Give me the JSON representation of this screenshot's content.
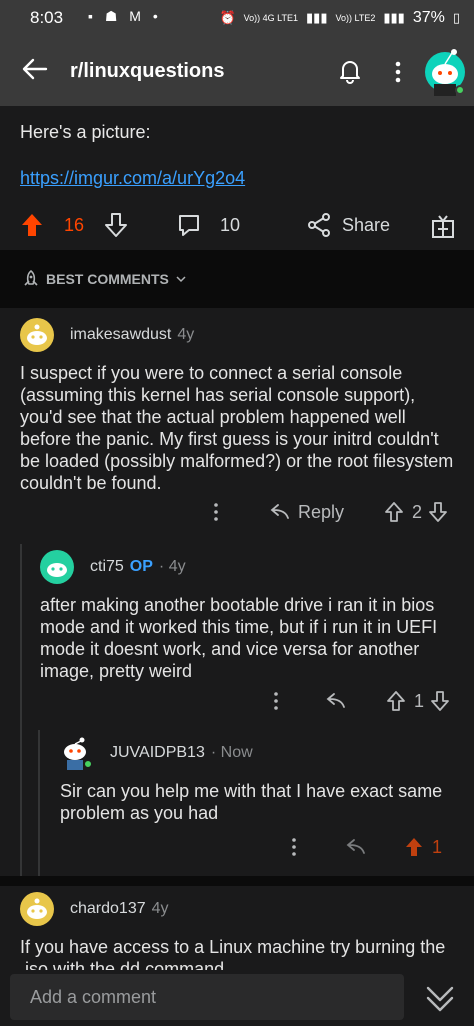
{
  "status_bar": {
    "time": "8:03",
    "left_icons": "▪ ☗ M •",
    "network_1": "Vo)) 4G LTE1",
    "network_2": "Vo)) LTE2",
    "battery": "37%"
  },
  "header": {
    "title": "r/linuxquestions"
  },
  "post": {
    "text": "Here's a picture:",
    "link": "https://imgur.com/a/urYg2o4",
    "upvotes": "16",
    "comments": "10",
    "share_label": "Share"
  },
  "sort": {
    "label": "BEST COMMENTS"
  },
  "comments": [
    {
      "user": "imakesawdust",
      "age": "4y",
      "body": "I suspect if you were to connect a serial console (assuming this kernel has serial console support), you'd see that the actual problem happened well before the panic.  My first guess is your initrd couldn't be loaded (possibly malformed?) or the root filesystem couldn't be found.",
      "reply_label": "Reply",
      "score": "2"
    },
    {
      "user": "cti75",
      "op_badge": "OP",
      "age": "· 4y",
      "body": "after making another bootable drive i ran it in bios mode and it worked this time, but if i run it in UEFI mode it doesnt work, and vice versa for another image, pretty weird",
      "score": "1"
    },
    {
      "user": "JUVAIDPB13",
      "age": "· Now",
      "body": "Sir can you help me with that I have exact same problem as you had",
      "score": "1"
    },
    {
      "user": "chardo137",
      "age": "4y",
      "body": "If you have access to a Linux machine try burning the .iso with the dd command"
    }
  ],
  "composer": {
    "placeholder": "Add a comment"
  },
  "colors": {
    "upvote": "#ff4500",
    "link": "#3aa0ff",
    "background": "#1a1a1b"
  }
}
